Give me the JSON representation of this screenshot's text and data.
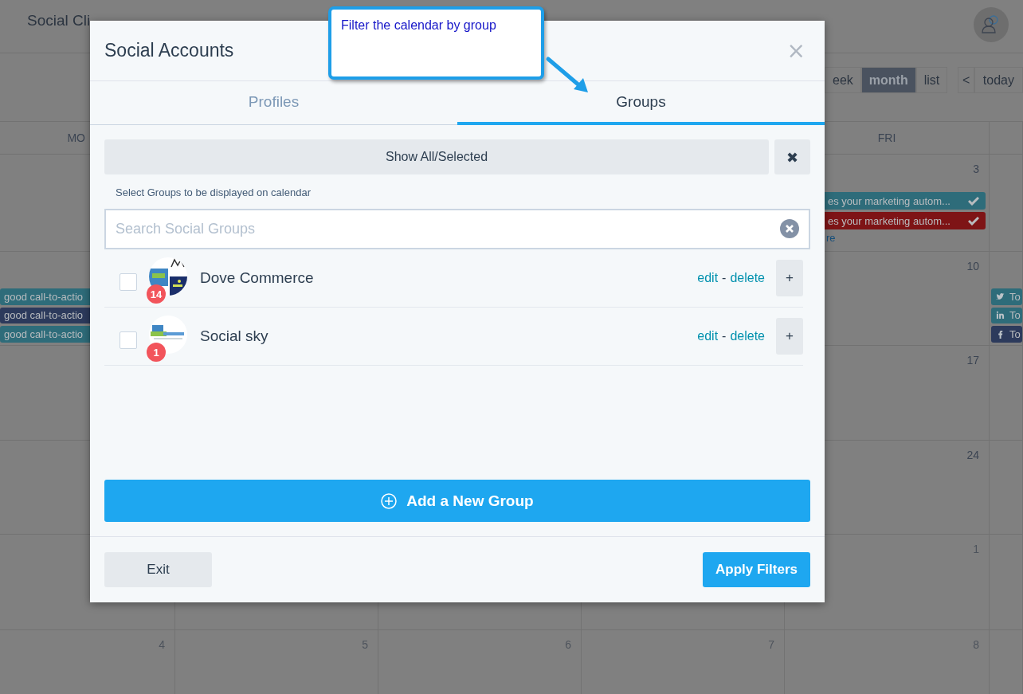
{
  "app": {
    "title": "Social Cli"
  },
  "view_switcher": [
    {
      "label": "eek",
      "selected": false
    },
    {
      "label": "month",
      "selected": true
    },
    {
      "label": "list",
      "selected": false
    }
  ],
  "nav": {
    "prev": "<",
    "today": "today"
  },
  "weekday_headers": {
    "mon": "MO",
    "fri": "FRI"
  },
  "weeks": [
    {
      "fri": {
        "day": "3",
        "other_month": false,
        "events": [
          {
            "text": "es your marketing autom...",
            "color": "#2e6c7a",
            "done": true
          },
          {
            "text": "es your marketing autom...",
            "color": "#7e1416",
            "done": true
          }
        ],
        "more": "re"
      }
    },
    {
      "mon": {
        "events": [
          {
            "text": "good call-to-actio",
            "color": "#2e6c7a"
          },
          {
            "text": "good call-to-actio",
            "color": "#2c3a5c"
          },
          {
            "text": "good call-to-actio",
            "color": "#2e6c7a"
          }
        ]
      },
      "fri": {
        "day": "10",
        "other_month": false
      },
      "sat": {
        "events": [
          {
            "kind": "twitter",
            "text": "To",
            "color": "#2e6c7a"
          },
          {
            "kind": "linkedin",
            "text": "To",
            "color": "#2e6c7a"
          },
          {
            "kind": "facebook",
            "text": "To",
            "color": "#2c3a5c"
          }
        ]
      }
    },
    {
      "fri": {
        "day": "17",
        "other_month": false
      }
    },
    {
      "fri": {
        "day": "24",
        "other_month": false
      }
    },
    {
      "fri": {
        "day": "1",
        "other_month": true
      }
    },
    {
      "mon": {
        "day": "4",
        "other_month": true
      },
      "tue": {
        "day": "5",
        "other_month": true
      },
      "wed": {
        "day": "6",
        "other_month": true
      },
      "thu": {
        "day": "7",
        "other_month": true
      },
      "fri": {
        "day": "8",
        "other_month": true
      }
    }
  ],
  "modal": {
    "title": "Social Accounts",
    "close": "×",
    "tabs": [
      {
        "label": "Profiles",
        "selected": false
      },
      {
        "label": "Groups",
        "selected": true
      }
    ],
    "show_all_button": "Show All/Selected",
    "clear_button": "✖",
    "hint": "Select Groups to be displayed on calendar",
    "search": {
      "placeholder": "Search Social Groups"
    },
    "groups": [
      {
        "name": "Dove Commerce",
        "count": "14",
        "checked": false,
        "kind": "collage",
        "edit": "edit",
        "separator": "-",
        "delete": "delete",
        "add": "+"
      },
      {
        "name": "Social sky",
        "count": "1",
        "checked": false,
        "kind": "single",
        "edit": "edit",
        "separator": "-",
        "delete": "delete",
        "add": "+"
      }
    ],
    "add_group_button": "Add a New Group",
    "exit_button": "Exit",
    "apply_button": "Apply Filters"
  },
  "callout": {
    "text": "Filter the calendar by group"
  }
}
